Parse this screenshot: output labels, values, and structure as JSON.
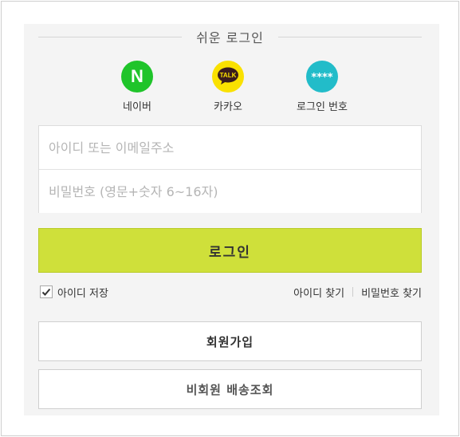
{
  "easy_login": {
    "title": "쉬운 로그인"
  },
  "social": [
    {
      "label": "네이버",
      "glyph": "N"
    },
    {
      "label": "카카오",
      "glyph": "TALK"
    },
    {
      "label": "로그인 번호",
      "glyph": "****"
    }
  ],
  "form": {
    "id_placeholder": "아이디 또는 이메일주소",
    "pw_placeholder": "비밀번호 (영문+숫자 6~16자)"
  },
  "login_button": "로그인",
  "save_id": {
    "label": "아이디 저장",
    "checked": true
  },
  "links": {
    "find_id": "아이디 찾기",
    "find_pw": "비밀번호 찾기"
  },
  "signup_button": "회원가입",
  "guest_button": "비회원 배송조회",
  "colors": {
    "accent": "#cfe03a",
    "naver": "#1fc42a",
    "kakao": "#fae100",
    "number_login": "#22bcc9"
  }
}
